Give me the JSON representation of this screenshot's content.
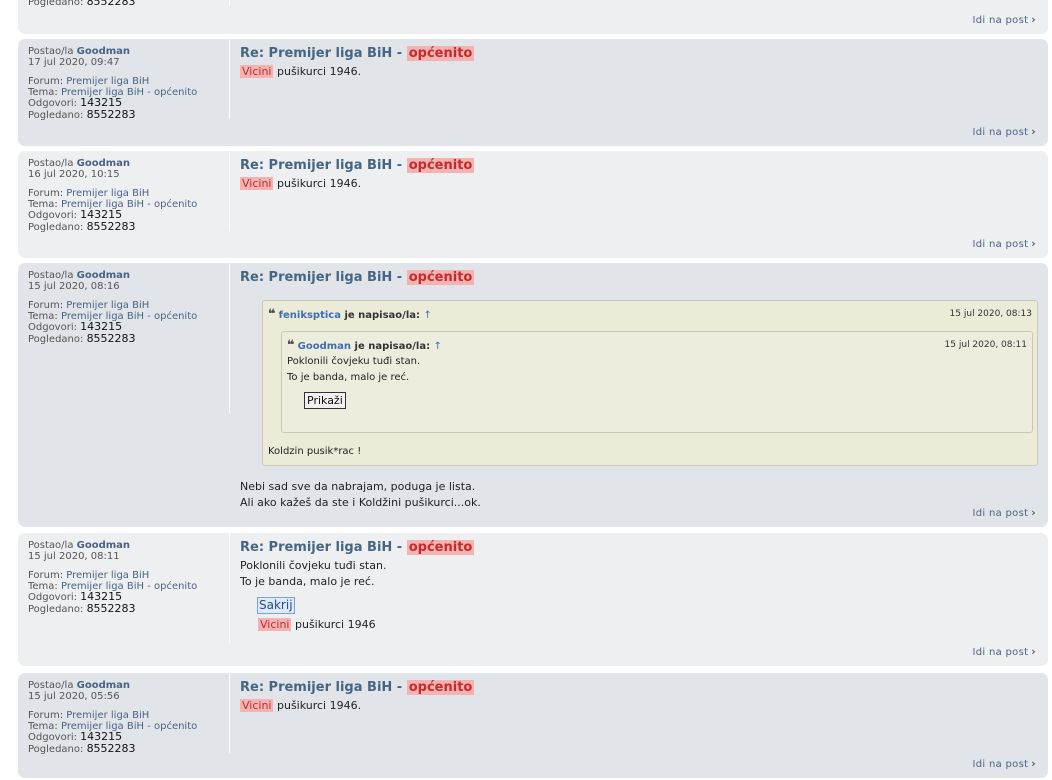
{
  "partial_post": {
    "views_label": "Pogledano:",
    "views": "8552283",
    "goto": "Idi na post"
  },
  "posts": [
    {
      "posted_label": "Postao/la",
      "author": "Goodman",
      "date": "17 jul 2020, 09:47",
      "forum_label": "Forum:",
      "forum": "Premijer liga BiH",
      "topic_label": "Tema:",
      "topic": "Premijer liga BiH - općenito",
      "replies_label": "Odgovori:",
      "replies": "143215",
      "views_label": "Pogledano:",
      "views": "8552283",
      "title_prefix": "Re: Premijer liga BiH -",
      "title_highlight": "općenito",
      "body_highlight": "Vicini",
      "body_text": "pušikurci 1946.",
      "goto": "Idi na post"
    },
    {
      "posted_label": "Postao/la",
      "author": "Goodman",
      "date": "16 jul 2020, 10:15",
      "forum_label": "Forum:",
      "forum": "Premijer liga BiH",
      "topic_label": "Tema:",
      "topic": "Premijer liga BiH - općenito",
      "replies_label": "Odgovori:",
      "replies": "143215",
      "views_label": "Pogledano:",
      "views": "8552283",
      "title_prefix": "Re: Premijer liga BiH -",
      "title_highlight": "općenito",
      "body_highlight": "Vicini",
      "body_text": "pušikurci 1946.",
      "goto": "Idi na post"
    },
    {
      "posted_label": "Postao/la",
      "author": "Goodman",
      "date": "15 jul 2020, 08:16",
      "forum_label": "Forum:",
      "forum": "Premijer liga BiH",
      "topic_label": "Tema:",
      "topic": "Premijer liga BiH - općenito",
      "replies_label": "Odgovori:",
      "replies": "143215",
      "views_label": "Pogledano:",
      "views": "8552283",
      "title_prefix": "Re: Premijer liga BiH -",
      "title_highlight": "općenito",
      "quote_outer": {
        "author": "feniksptica",
        "wrote": "je napisao/la:",
        "arrow": "↑",
        "date": "15 jul 2020, 08:13",
        "text": "Koldzin pusik*rac !"
      },
      "quote_inner": {
        "author": "Goodman",
        "wrote": "je napisao/la:",
        "arrow": "↑",
        "date": "15 jul 2020, 08:11",
        "line1": "Poklonili čovjeku tuđi stan.",
        "line2": "To je banda, malo je reć.",
        "show_button": "Prikaži"
      },
      "body_line1": "Nebi sad sve da nabrajam, poduga je lista.",
      "body_line2": "Ali ako kažeš da ste i Koldžini pušikurci...ok.",
      "goto": "Idi na post"
    },
    {
      "posted_label": "Postao/la",
      "author": "Goodman",
      "date": "15 jul 2020, 08:11",
      "forum_label": "Forum:",
      "forum": "Premijer liga BiH",
      "topic_label": "Tema:",
      "topic": "Premijer liga BiH - općenito",
      "replies_label": "Odgovori:",
      "replies": "143215",
      "views_label": "Pogledano:",
      "views": "8552283",
      "title_prefix": "Re: Premijer liga BiH -",
      "title_highlight": "općenito",
      "body_line1": "Poklonili čovjeku tuđi stan.",
      "body_line2": "To je banda, malo je reć.",
      "hide_button": "Sakrij",
      "spoiler_highlight": "Vicini",
      "spoiler_text": "pušikurci 1946",
      "goto": "Idi na post"
    },
    {
      "posted_label": "Postao/la",
      "author": "Goodman",
      "date": "15 jul 2020, 05:56",
      "forum_label": "Forum:",
      "forum": "Premijer liga BiH",
      "topic_label": "Tema:",
      "topic": "Premijer liga BiH - općenito",
      "replies_label": "Odgovori:",
      "replies": "143215",
      "views_label": "Pogledano:",
      "views": "8552283",
      "title_prefix": "Re: Premijer liga BiH -",
      "title_highlight": "općenito",
      "body_highlight": "Vicini",
      "body_text": "pušikurci 1946.",
      "goto": "Idi na post"
    }
  ]
}
